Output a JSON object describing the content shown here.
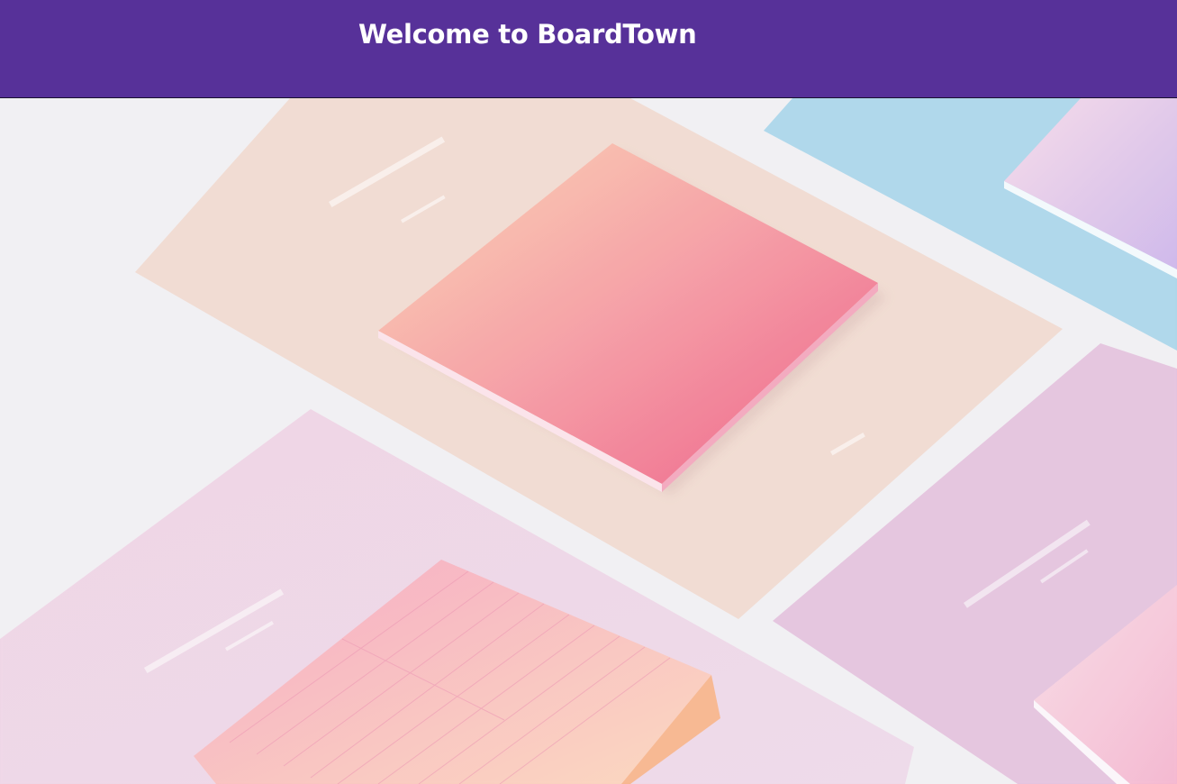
{
  "header": {
    "title": "Welcome to BoardTown",
    "background": "#573199",
    "text_color": "#ffffff"
  },
  "hero": {
    "alt": "Pastel gradient sticky note pads arranged diagonally on pastel card backings",
    "colors": {
      "background": "#f1f0f3",
      "peach_card": "#f1d9cf",
      "blue_card": "#acd6ea",
      "pink_card": "#efd6e6",
      "lilac_card": "#e4c2dd",
      "pad_gradient_start": "#f9d2b0",
      "pad_gradient_end": "#ef5d86"
    }
  }
}
